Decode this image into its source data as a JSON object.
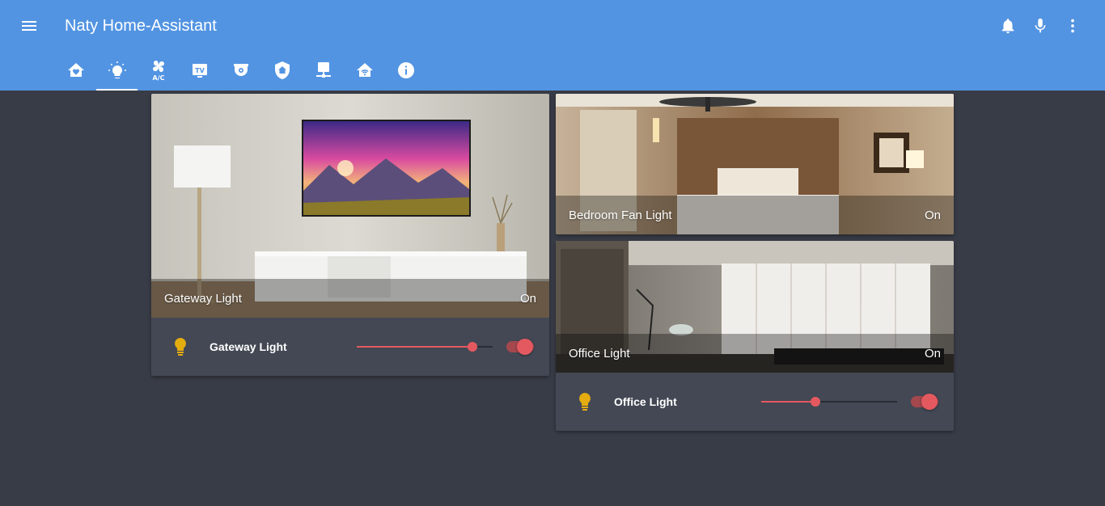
{
  "header": {
    "title": "Naty Home-Assistant",
    "actions": [
      "bell-icon",
      "microphone-icon",
      "more-vertical-icon"
    ]
  },
  "tabs": [
    {
      "icon": "home-heart-icon",
      "active": false
    },
    {
      "icon": "lightbulb-icon",
      "active": true
    },
    {
      "icon": "fan-ac-icon",
      "active": false
    },
    {
      "icon": "tv-icon",
      "active": false
    },
    {
      "icon": "camera-dome-icon",
      "active": false
    },
    {
      "icon": "shield-home-icon",
      "active": false
    },
    {
      "icon": "desktop-network-icon",
      "active": false
    },
    {
      "icon": "home-wifi-icon",
      "active": false
    },
    {
      "icon": "info-icon",
      "active": false
    }
  ],
  "cards": {
    "gateway": {
      "image_label": "Gateway Light",
      "image_state": "On",
      "control_name": "Gateway Light",
      "brightness_fraction": 0.85,
      "toggle_on": true
    },
    "bedroom": {
      "image_label": "Bedroom Fan Light",
      "image_state": "On"
    },
    "office": {
      "image_label": "Office Light",
      "image_state": "On",
      "control_name": "Office Light",
      "brightness_fraction": 0.4,
      "toggle_on": true
    }
  },
  "colors": {
    "header": "#5294e2",
    "background": "#383c46",
    "card": "#434854",
    "accent": "#e4595f",
    "bulb": "#e5ac10"
  }
}
